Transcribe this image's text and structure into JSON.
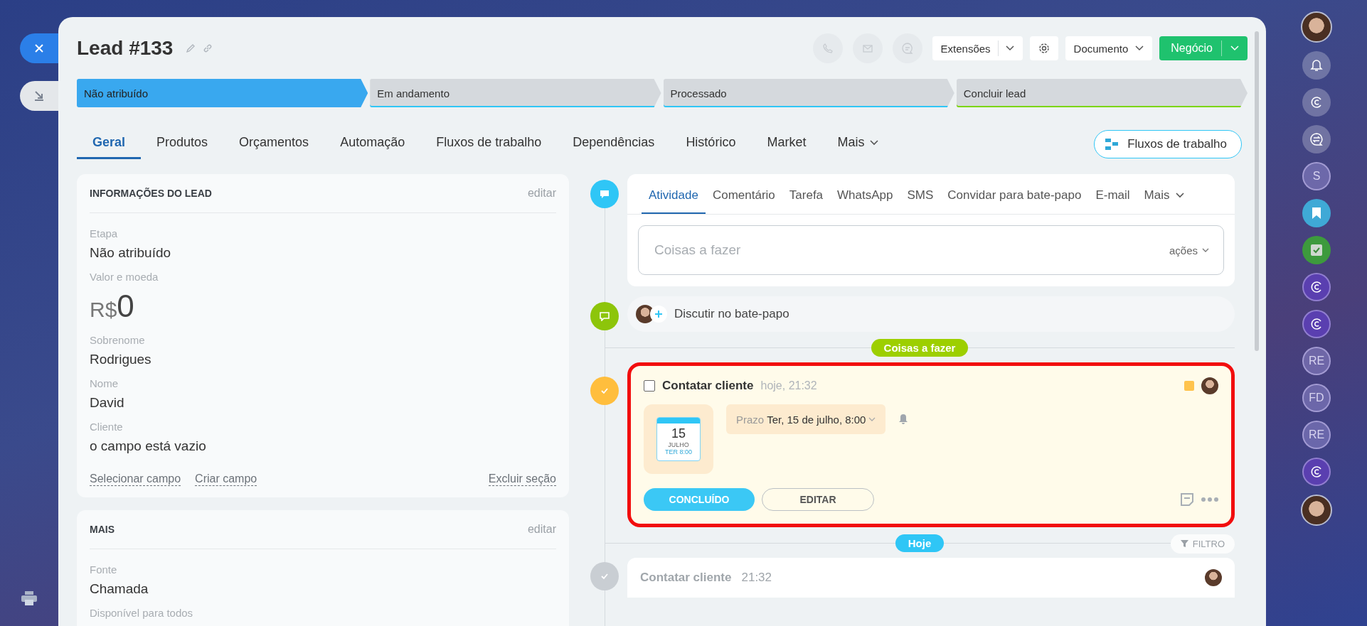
{
  "header": {
    "title": "Lead #133",
    "extensions_button": "Extensões",
    "document_button": "Documento",
    "primary_button": "Negócio"
  },
  "stages": [
    {
      "label": "Não atribuído",
      "selected": true,
      "color": "#39a8ef"
    },
    {
      "label": "Em andamento",
      "selected": false,
      "color": "#2fc6f6"
    },
    {
      "label": "Processado",
      "selected": false,
      "color": "#2fc6f6"
    },
    {
      "label": "Concluir lead",
      "selected": false,
      "color": "#7bd500"
    }
  ],
  "tabs": [
    {
      "label": "Geral",
      "selected": true,
      "kind": "tab"
    },
    {
      "label": "Produtos",
      "selected": false,
      "kind": "tab"
    },
    {
      "label": "Orçamentos",
      "selected": false,
      "kind": "tab"
    },
    {
      "label": "Automação",
      "selected": false,
      "kind": "tab"
    },
    {
      "label": "Fluxos de trabalho",
      "selected": false,
      "kind": "tab"
    },
    {
      "label": "Dependências",
      "selected": false,
      "kind": "tab"
    },
    {
      "label": "Histórico",
      "selected": false,
      "kind": "tab"
    },
    {
      "label": "Market",
      "selected": false,
      "kind": "tab"
    },
    {
      "label": "Mais",
      "selected": false,
      "kind": "menu"
    }
  ],
  "workflow_button": "Fluxos de trabalho",
  "sections": [
    {
      "title": "INFORMAÇÕES DO LEAD",
      "edit": "editar",
      "fields": [
        {
          "kind": "text",
          "label": "Etapa",
          "value": "Não atribuído"
        },
        {
          "kind": "money",
          "label": "Valor e moeda",
          "currency": "R$",
          "value": "0"
        },
        {
          "kind": "text",
          "label": "Sobrenome",
          "value": "Rodrigues"
        },
        {
          "kind": "text",
          "label": "Nome",
          "value": "David"
        },
        {
          "kind": "text",
          "label": "Cliente",
          "value": "o campo está vazio"
        }
      ],
      "links": [
        "Selecionar campo",
        "Criar campo"
      ],
      "remove_link": "Excluir seção"
    },
    {
      "title": "MAIS",
      "edit": "editar",
      "fields": [
        {
          "kind": "text",
          "label": "Fonte",
          "value": "Chamada"
        },
        {
          "kind": "label",
          "label": "Disponível para todos"
        }
      ]
    }
  ],
  "activity": {
    "tabs": [
      {
        "label": "Atividade",
        "selected": true,
        "kind": "tab"
      },
      {
        "label": "Comentário",
        "selected": false,
        "kind": "tab"
      },
      {
        "label": "Tarefa",
        "selected": false,
        "kind": "tab"
      },
      {
        "label": "WhatsApp",
        "selected": false,
        "kind": "tab"
      },
      {
        "label": "SMS",
        "selected": false,
        "kind": "tab"
      },
      {
        "label": "Convidar para bate-papo",
        "selected": false,
        "kind": "tab"
      },
      {
        "label": "E-mail",
        "selected": false,
        "kind": "tab"
      },
      {
        "label": "Mais",
        "selected": false,
        "kind": "menu"
      }
    ],
    "placeholder": "Coisas a fazer",
    "actions": "ações"
  },
  "chat": {
    "label": "Discutir no bate-papo"
  },
  "todo_badge": "Coisas a fazer",
  "task": {
    "checked": false,
    "title": "Contatar cliente",
    "time": "hoje, 21:32",
    "calendar_day": "15",
    "calendar_month": "JULHO",
    "calendar_time": "TER 8:00",
    "deadline_label": "Prazo",
    "deadline": "Ter, 15 de julho, 8:00",
    "done_button": "CONCLUÍDO",
    "edit_button": "EDITAR"
  },
  "today_badge": "Hoje",
  "filter": "FILTRO",
  "history": [
    {
      "title": "Contatar cliente",
      "time": "21:32"
    }
  ],
  "sidebar": [
    {
      "kind": "avatar"
    },
    {
      "kind": "bell"
    },
    {
      "kind": "copilot"
    },
    {
      "kind": "exchange"
    },
    {
      "kind": "letter",
      "label": "S"
    },
    {
      "kind": "bookmark"
    },
    {
      "kind": "task"
    },
    {
      "kind": "copilot-purple"
    },
    {
      "kind": "copilot-purple"
    },
    {
      "kind": "letter",
      "label": "RE"
    },
    {
      "kind": "letter",
      "label": "FD"
    },
    {
      "kind": "letter",
      "label": "RE"
    },
    {
      "kind": "copilot-purple"
    },
    {
      "kind": "avatar"
    }
  ]
}
